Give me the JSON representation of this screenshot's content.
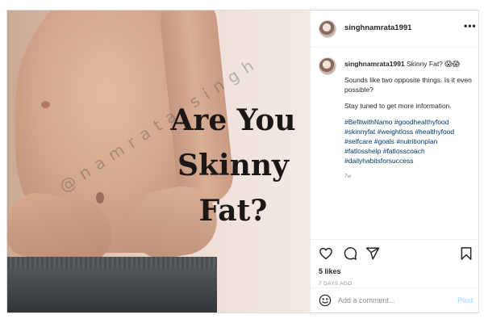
{
  "photo": {
    "headline_line1": "Are You",
    "headline_line2": "Skinny",
    "headline_line3": "Fat?",
    "watermark": "@namrata singh"
  },
  "header": {
    "username": "singhnamrata1991",
    "more_icon": "more-horizontal-icon",
    "more_label": "•••"
  },
  "caption": {
    "username": "singhnamrata1991",
    "title": "Skinny Fat?",
    "emoji": "😱😱",
    "para1": "Sounds like two opposite things. Is it even possible?",
    "para2": "Stay tuned to get more information.",
    "hashtags": [
      "#BefitwithNamo",
      "#goodhealthyfood",
      "#skinnyfat",
      "#weightloss",
      "#healthyfood",
      "#selfcare",
      "#goals",
      "#nutritionplan",
      "#fatlosshelp",
      "#fatlosscoach",
      "#dailyhabitsforsuccess"
    ],
    "time_short": "7w"
  },
  "actions": {
    "icons": [
      "heart-icon",
      "comment-icon",
      "share-icon",
      "bookmark-icon"
    ],
    "likes": "5 likes",
    "time_ago": "7 DAYS AGO"
  },
  "comment": {
    "placeholder": "Add a comment...",
    "post_label": "Post",
    "emoji_icon": "smile-icon"
  },
  "colors": {
    "text": "#262626",
    "hashtag": "#00376b",
    "muted": "#8e8e8e",
    "post_disabled": "#b2dffc",
    "border": "#dbdbdb"
  }
}
